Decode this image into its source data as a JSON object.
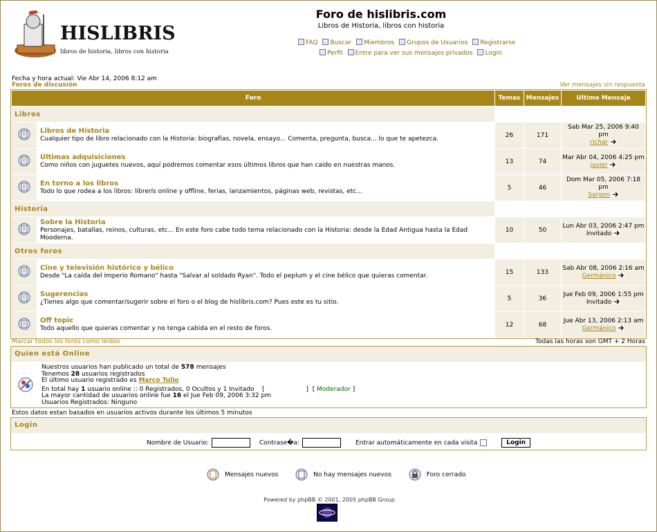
{
  "header": {
    "logo_text": "HISLIBRIS",
    "logo_subtitle": "libros de historia, libros con historia",
    "site_title": "Foro de hislibris.com",
    "site_desc": "Libros de Historia, libros con historia",
    "nav_row1": [
      {
        "label": "FAQ",
        "icon": "faq-icon"
      },
      {
        "label": "Buscar",
        "icon": "search-icon"
      },
      {
        "label": "Miembros",
        "icon": "members-icon"
      },
      {
        "label": "Grupos de Usuarios",
        "icon": "groups-icon"
      },
      {
        "label": "Registrarse",
        "icon": "register-icon"
      }
    ],
    "nav_row2": [
      {
        "label": "Perfil",
        "icon": "profile-icon"
      },
      {
        "label": "Entre para ver sus mensajes privados",
        "icon": "messages-icon"
      },
      {
        "label": "Login",
        "icon": "login-icon"
      }
    ]
  },
  "datetime": "Fecha y hora actual: Vie Abr 14, 2006 8:12 am",
  "forums_link": "Foros de discusión",
  "unanswered_link": "Ver mensajes sin respuesta",
  "table_headers": {
    "forum": "Foro",
    "topics": "Temas",
    "posts": "Mensajes",
    "last": "Ultimo Mensaje"
  },
  "categories": [
    {
      "name": "Libros",
      "forums": [
        {
          "name": "Libros de Historia",
          "desc": "Cualquier tipo de libro relacionado con la Historia: biografías, novela, ensayo... Comenta, pregunta, busca... lo que te apetezca.",
          "topics": "26",
          "posts": "171",
          "last_date": "Sab Mar 25, 2006 9:40 pm",
          "last_user": "richar",
          "last_user_linked": true
        },
        {
          "name": "Últimas adquisiciones",
          "desc": "Como niños con juguetes nuevos, aquí podremos comentar esos últimos libros que han caído en nuestras manos.",
          "topics": "13",
          "posts": "74",
          "last_date": "Mar Abr 04, 2006 4:25 pm",
          "last_user": "javier",
          "last_user_linked": true
        },
        {
          "name": "En torno a los libros",
          "desc": "Todo lo que rodea a los libros: librerís online y offline, ferias, lanzamientos, páginas web, revistas, etc...",
          "topics": "5",
          "posts": "46",
          "last_date": "Dom Mar 05, 2006 7:18 pm",
          "last_user": "Sargon",
          "last_user_linked": true
        }
      ]
    },
    {
      "name": "Historia",
      "forums": [
        {
          "name": "Sobre la Historia",
          "desc": "Personajes, batallas, reinos, culturas, etc... En este foro cabe todo tema relacionado con la Historia: desde la Edad Antigua hasta la Edad Mooderna.",
          "topics": "10",
          "posts": "50",
          "last_date": "Lun Abr 03, 2006 2:47 pm",
          "last_user": "Invitado",
          "last_user_linked": false
        }
      ]
    },
    {
      "name": "Otros foros",
      "forums": [
        {
          "name": "Cine y televisión histórico y bélico",
          "desc": "Desde \"La caída del Imperio Romano\" hasta \"Salvar al soldado Ryan\". Todo el peplum y el cine bélico que quieras comentar.",
          "topics": "15",
          "posts": "133",
          "last_date": "Sab Abr 08, 2006 2:16 am",
          "last_user": "Germánico",
          "last_user_linked": true
        },
        {
          "name": "Sugerencias",
          "desc": "¿Tienes algo que comentar/sugerir sobre el foro o el blog de hislibris.com? Pues este es tu sitio.",
          "topics": "5",
          "posts": "36",
          "last_date": "Jue Feb 09, 2006 1:55 pm",
          "last_user": "Invitado",
          "last_user_linked": false
        },
        {
          "name": "Off topic",
          "desc": "Todo aquello que quieras comentar y no tenga cabida en el resto de foros.",
          "topics": "12",
          "posts": "68",
          "last_date": "Jue Abr 13, 2006 2:13 am",
          "last_user": "Germánico",
          "last_user_linked": true
        }
      ]
    }
  ],
  "mark_read": "Marcar todos los foros como leídos",
  "timezone": "Todas las horas son GMT + 2 Horas",
  "online": {
    "title": "Quien está Online",
    "line1_pre": "Nuestros usuarios han publicado un total de ",
    "line1_num": "578",
    "line1_post": " mensajes",
    "line2_pre": "Tenemos ",
    "line2_num": "28",
    "line2_post": " usuarios registrados",
    "line3_pre": "El último usuario registrado es ",
    "line3_user": "Marco Tulio",
    "line4_pre": "En total hay ",
    "line4_num": "1",
    "line4_post": " usuario online :: 0 Registrados, 0 Ocultos y 1 Invitado",
    "legend_open": "[",
    "legend_close": "]",
    "moderator_open": "[",
    "moderator": "Moderador",
    "moderator_close": "]",
    "line5_pre": "La mayor cantidad de usuarios online fue ",
    "line5_num": "16",
    "line5_post": " el Jue Feb 09, 2006 3:32 pm",
    "line6": "Usuarios Registrados: Ninguno"
  },
  "active_note": "Estos datos estan basados en usuarios activos durante los últimos 5 minutos",
  "login": {
    "title": "Login",
    "username_label": "Nombre de Usuario:",
    "password_label": "Contrase�a:",
    "auto_label": "Entrar automáticamente en cada visita",
    "button": "Login"
  },
  "legend": {
    "new": "Mensajes nuevos",
    "no_new": "No hay mensajes nuevos",
    "locked": "Foro cerrado"
  },
  "powered": "Powered by phpBB © 2001, 2005 phpBB Group",
  "colors": {
    "accent": "#a68519",
    "row_bg": "#f2eee2",
    "border": "#b89c3e"
  }
}
